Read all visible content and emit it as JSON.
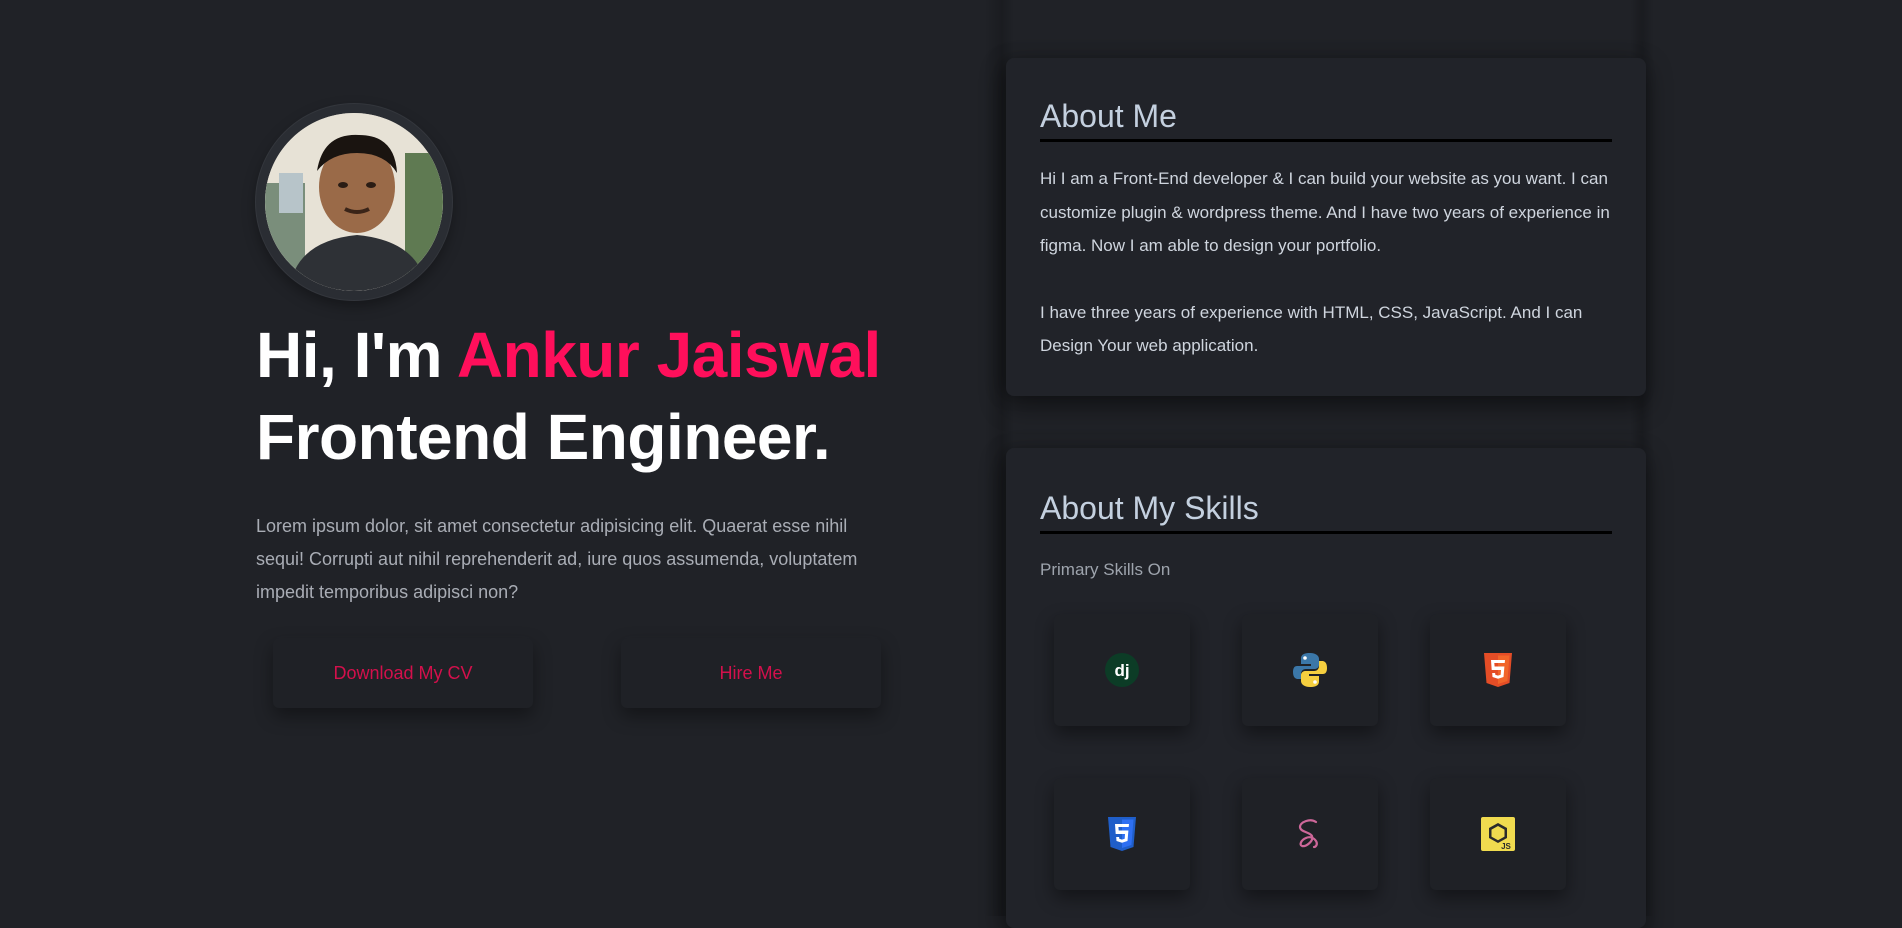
{
  "hero": {
    "greeting": "Hi, I'm ",
    "name": "Ankur Jaiswal",
    "role": "Frontend Engineer.",
    "intro": "Lorem ipsum dolor, sit amet consectetur adipisicing elit. Quaerat esse nihil sequi! Corrupti aut nihil reprehenderit ad, iure quos assumenda, voluptatem impedit temporibus adipisci non?",
    "buttons": {
      "cv": "Download My CV",
      "hire": "Hire Me"
    }
  },
  "about": {
    "title": "About Me",
    "paragraphs": [
      "Hi I am a Front-End developer & I can build your website as you want. I can customize plugin & wordpress theme. And I have two years of experience in figma. Now I am able to design your portfolio.",
      "I have three years of experience with HTML, CSS, JavaScript. And I can Design Your web application."
    ]
  },
  "skills": {
    "title": "About My Skills",
    "subtitle": "Primary Skills On",
    "icons": [
      "django-icon",
      "python-icon",
      "html5-icon",
      "css3-icon",
      "sass-icon",
      "javascript-icon"
    ]
  },
  "colors": {
    "accent": "#ff0f5b",
    "background": "#202227",
    "card": "#212329"
  }
}
